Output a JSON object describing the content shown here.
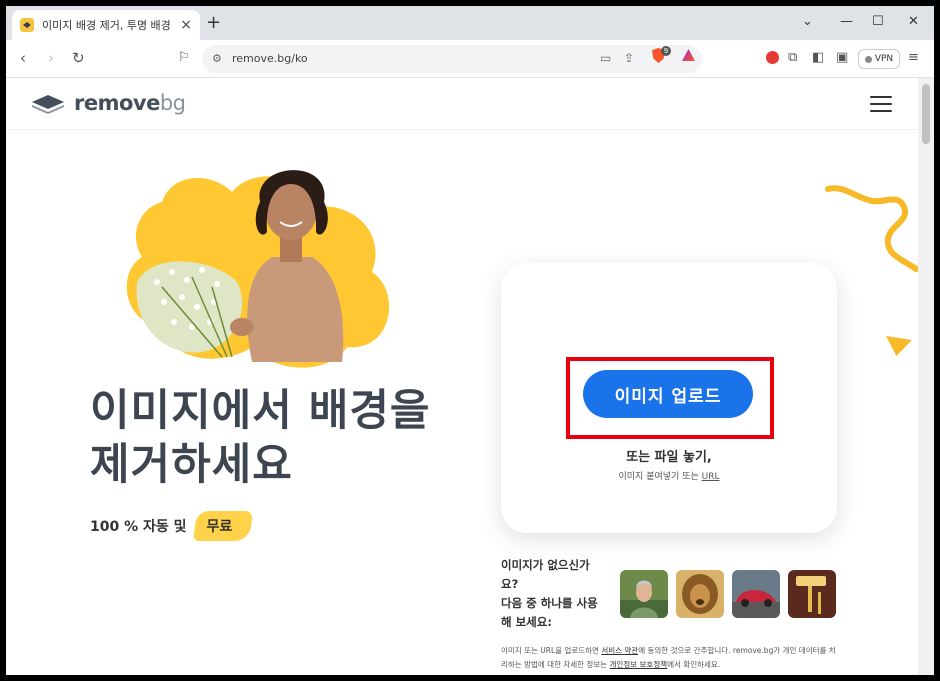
{
  "browser": {
    "tab_title": "이미지 배경 제거, 투명 배경 만",
    "url": "remove.bg/ko",
    "vpn_label": "VPN",
    "brave_badge": "9"
  },
  "header": {
    "logo_main": "remove",
    "logo_suffix": "bg"
  },
  "hero": {
    "headline_line1": "이미지에서 배경을",
    "headline_line2": "제거하세요",
    "subline_prefix": "100 % 자동 및",
    "subline_badge": "무료"
  },
  "upload": {
    "button_label": "이미지 업로드",
    "drop_text": "또는 파일 놓기,",
    "paste_text": "이미지 붙여넣기 또는",
    "url_link": "URL"
  },
  "samples": {
    "label_line1": "이미지가 없으신가",
    "label_line2": "요?",
    "label_line3": "다음 중 하나를 사용",
    "label_line4": "해 보세요:",
    "items": [
      "person",
      "lion",
      "car",
      "paint-roller"
    ]
  },
  "legal": {
    "part1": "이미지 또는 URL을 업로드하면 ",
    "tos_link": "서비스 약관",
    "part2": "에 동의한 것으로 간주합니다. remove.bg가 개인 데이터를 처리하는 방법에 대한 자세한 정보는 ",
    "privacy_link": "개인정보 보호정책",
    "part3": "에서 확인하세요."
  },
  "colors": {
    "accent_blue": "#1a73e8",
    "highlight_red": "#e8000e",
    "brand_yellow": "#ffd24a"
  }
}
